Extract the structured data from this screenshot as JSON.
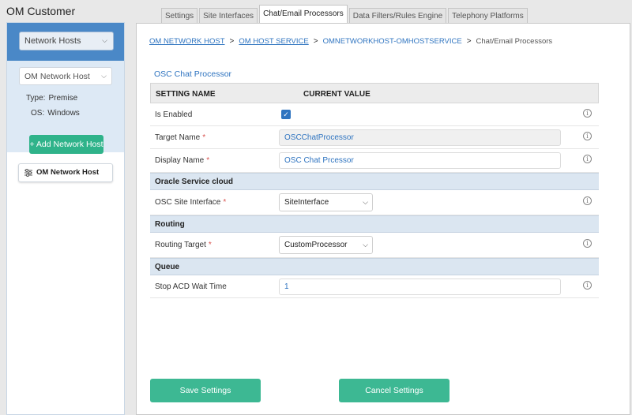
{
  "app": {
    "title": "OM Customer"
  },
  "sidebar": {
    "category_select": "Network Hosts",
    "host_select": "OM Network Host",
    "type_label": "Type:",
    "type_value": "Premise",
    "os_label": "OS:",
    "os_value": "Windows",
    "add_button": "+ Add Network Host",
    "host_item": "OM Network Host"
  },
  "tabs": [
    {
      "label": "Settings"
    },
    {
      "label": "Site Interfaces"
    },
    {
      "label": "Chat/Email Processors",
      "active": true
    },
    {
      "label": "Data Filters/Rules Engine"
    },
    {
      "label": "Telephony Platforms"
    }
  ],
  "breadcrumb": {
    "items": [
      "OM NETWORK HOST",
      "OM HOST SERVICE",
      "OMNETWORKHOST-OMHOSTSERVICE",
      "Chat/Email Processors"
    ],
    "separator": ">"
  },
  "section_title": "OSC Chat Processor",
  "grid": {
    "header_setting": "SETTING NAME",
    "header_value": "CURRENT VALUE",
    "is_enabled": {
      "label": "Is Enabled",
      "checked": true
    },
    "target_name": {
      "label": "Target Name",
      "value": "OSCChatProcessor"
    },
    "display_name": {
      "label": "Display Name",
      "value": "OSC Chat Prcessor"
    },
    "group_oracle": "Oracle Service cloud",
    "site_interface": {
      "label": "OSC Site Interface",
      "value": "SiteInterface"
    },
    "group_routing": "Routing",
    "routing_target": {
      "label": "Routing Target",
      "value": "CustomProcessor"
    },
    "group_queue": "Queue",
    "stop_acd": {
      "label": "Stop ACD Wait Time",
      "value": "1"
    },
    "required_mark": "*",
    "info_glyph": "i"
  },
  "buttons": {
    "save": "Save Settings",
    "cancel": "Cancel Settings"
  },
  "colors": {
    "accent_blue": "#2f74c0",
    "sidebar_blue": "#4a88c7",
    "green": "#3db893",
    "required_red": "#d9534f"
  },
  "icons": [
    "chevron-down-icon",
    "sliders-icon",
    "info-icon",
    "checkmark-icon"
  ]
}
